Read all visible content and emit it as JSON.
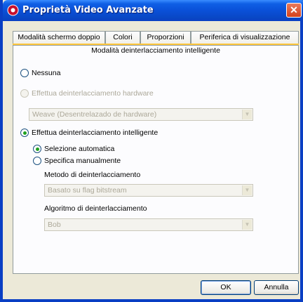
{
  "window": {
    "title": "Proprietà Video Avanzate",
    "close_label": "✕"
  },
  "tabs": [
    {
      "label": "Modalità schermo doppio",
      "active": false
    },
    {
      "label": "Colori",
      "active": false
    },
    {
      "label": "Proporzioni",
      "active": false
    },
    {
      "label": "Periferica di visualizzazione",
      "active": false
    }
  ],
  "panel": {
    "active_tab_label": "Modalità deinterlacciamento intelligente",
    "options": {
      "none": {
        "label": "Nessuna",
        "checked": false,
        "enabled": true
      },
      "hardware": {
        "label": "Effettua deinterlacciamento hardware",
        "checked": false,
        "enabled": false
      },
      "hardware_select": {
        "value": "Weave (Desentrelazado de hardware)",
        "enabled": false
      },
      "smart": {
        "label": "Effettua deinterlacciamento intelligente",
        "checked": true,
        "enabled": true
      },
      "auto": {
        "label": "Selezione automatica",
        "checked": true,
        "enabled": true
      },
      "manual": {
        "label": "Specifica manualmente",
        "checked": false,
        "enabled": true
      }
    },
    "method": {
      "label": "Metodo di deinterlacciamento",
      "value": "Basato su flag bitstream",
      "enabled": false
    },
    "algorithm": {
      "label": "Algoritmo di deinterlacciamento",
      "value": "Bob",
      "enabled": false
    }
  },
  "buttons": {
    "ok": "OK",
    "cancel": "Annulla"
  },
  "colors": {
    "title_bar": "#0a50d8",
    "active_tab_accent": "#ffc83c",
    "radio_check": "#21a121",
    "close_button": "#d6421a"
  }
}
